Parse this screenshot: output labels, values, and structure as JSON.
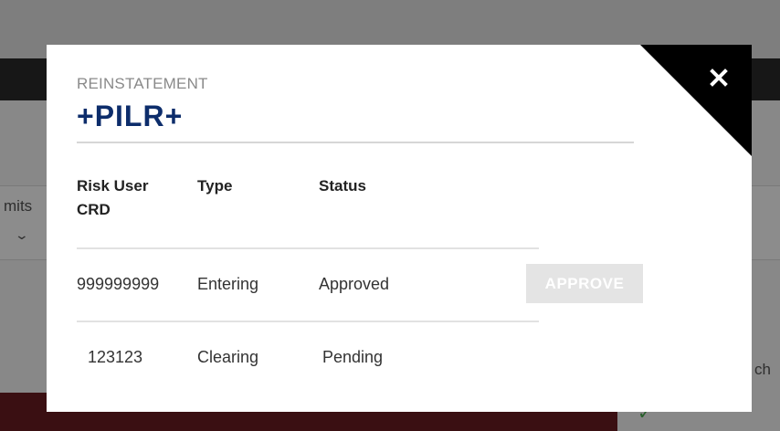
{
  "background": {
    "filter_label_fragment": "mits",
    "search_fragment": "ch"
  },
  "modal": {
    "eyebrow": "REINSTATEMENT",
    "title": "+PILR+",
    "close_icon": "close-icon",
    "columns": {
      "crd": "Risk User CRD",
      "type": "Type",
      "status": "Status"
    },
    "rows": [
      {
        "crd": "999999999",
        "type": "Entering",
        "status": "Approved",
        "action": "APPROVE",
        "action_disabled": true
      },
      {
        "crd": "123123",
        "type": "Clearing",
        "status": "Pending"
      }
    ]
  },
  "colors": {
    "title": "#0d2d6b",
    "corner": "#000000",
    "button_disabled_bg": "#e4e4e4",
    "background_red_bar": "#6b1d22"
  }
}
